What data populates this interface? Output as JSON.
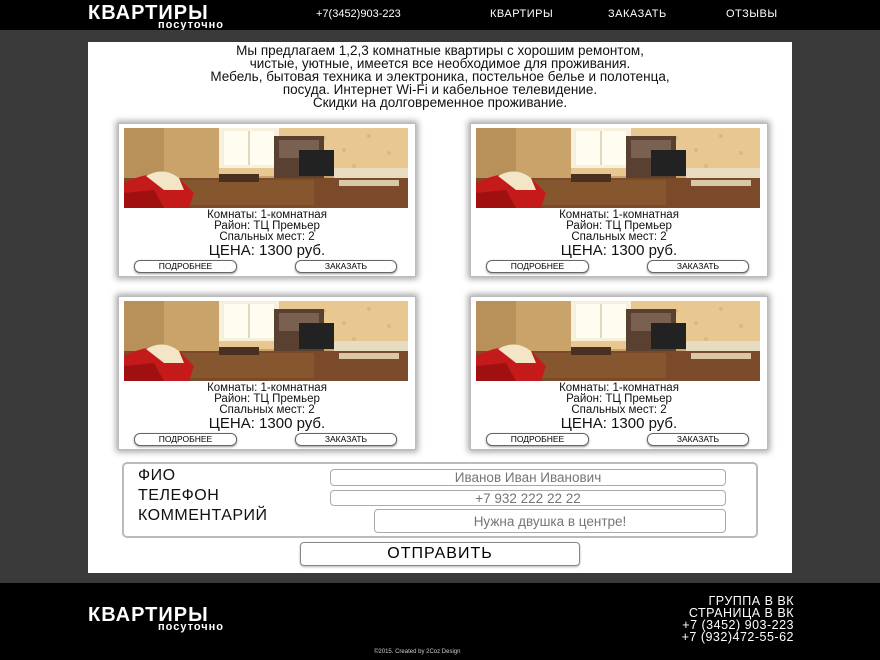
{
  "header": {
    "logo_line1": "КВАРТИРЫ",
    "logo_line2": "посуточно",
    "phone": "+7(3452)903-223",
    "nav": [
      "КВАРТИРЫ",
      "ЗАКАЗАТЬ",
      "ОТЗЫВЫ"
    ]
  },
  "intro": {
    "line1": "Мы предлагаем 1,2,3 комнатные квартиры с хорошим ремонтом,",
    "line2": "чистые, уютные, имеется все необходимое для проживания.",
    "line3": "Мебель, бытовая техника и электроника, постельное белье и полотенца,",
    "line4": "посуда. Интернет Wi-Fi и кабельное телевидение.",
    "line5": "Скидки на долговременное проживание."
  },
  "cards": [
    {
      "rooms": "Комнаты: 1-комнатная",
      "district": "Район: ТЦ Премьер",
      "beds": "Спальных мест: 2",
      "price": "ЦЕНА: 1300 руб.",
      "details_label": "ПОДРОБНЕЕ",
      "order_label": "ЗАКАЗАТЬ"
    },
    {
      "rooms": "Комнаты: 1-комнатная",
      "district": "Район: ТЦ Премьер",
      "beds": "Спальных мест: 2",
      "price": "ЦЕНА: 1300 руб.",
      "details_label": "ПОДРОБНЕЕ",
      "order_label": "ЗАКАЗАТЬ"
    },
    {
      "rooms": "Комнаты: 1-комнатная",
      "district": "Район: ТЦ Премьер",
      "beds": "Спальных мест: 2",
      "price": "ЦЕНА: 1300 руб.",
      "details_label": "ПОДРОБНЕЕ",
      "order_label": "ЗАКАЗАТЬ"
    },
    {
      "rooms": "Комнаты: 1-комнатная",
      "district": "Район: ТЦ Премьер",
      "beds": "Спальных мест: 2",
      "price": "ЦЕНА: 1300 руб.",
      "details_label": "ПОДРОБНЕЕ",
      "order_label": "ЗАКАЗАТЬ"
    }
  ],
  "form": {
    "name_label": "ФИО",
    "name_placeholder": "Иванов Иван Иванович",
    "phone_label": "ТЕЛЕФОН",
    "phone_placeholder": "+7 932 222 22 22",
    "comment_label": "КОММЕНТАРИЙ",
    "comment_placeholder": "Нужна двушка в центре!",
    "submit_label": "ОТПРАВИТЬ"
  },
  "footer": {
    "logo_line1": "КВАРТИРЫ",
    "logo_line2": "посуточно",
    "vk_group": "ГРУППА В ВК",
    "vk_page": "СТРАНИЦА В ВК",
    "phone1": "+7 (3452) 903-223",
    "phone2": "+7 (932)472-55-62",
    "copyright": "©2015. Created by 2Coz Design"
  },
  "colors": {
    "page_background": "#3a3a3a",
    "bar_background": "#000000",
    "content_background": "#ffffff"
  },
  "icons": {
    "apartment_photo": "room-photo"
  }
}
